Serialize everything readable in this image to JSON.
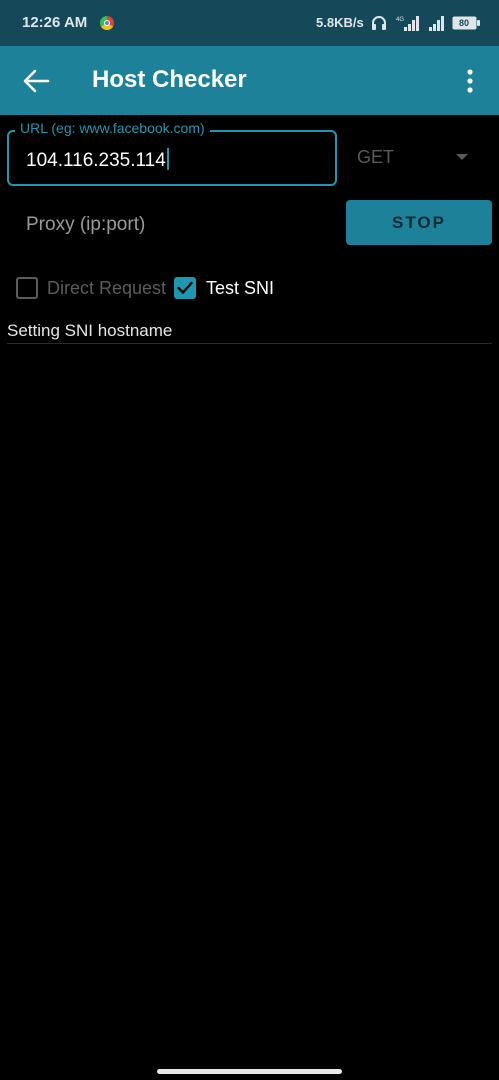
{
  "status_bar": {
    "time": "12:26 AM",
    "speed": "5.8KB/s",
    "battery": "80",
    "icons": [
      "chrome-icon",
      "headphone-icon",
      "signal-icon",
      "signal-icon",
      "battery-icon"
    ]
  },
  "app_bar": {
    "title": "Host Checker",
    "back_icon": "arrow-left",
    "menu_icon": "more-vertical",
    "color": "#1d8299"
  },
  "form": {
    "url_label": "URL (eg: www.facebook.com)",
    "url_value": "104.116.235.114",
    "method": "GET",
    "proxy_placeholder": "Proxy (ip:port)",
    "stop_label": "STOP"
  },
  "options": {
    "direct_request": {
      "label": "Direct Request",
      "checked": false
    },
    "test_sni": {
      "label": "Test SNI",
      "checked": true
    }
  },
  "log": {
    "lines": [
      "Setting SNI hostname"
    ]
  },
  "colors": {
    "accent": "#1f97b0",
    "status_bar_bg": "#15495a",
    "background": "#000000"
  }
}
